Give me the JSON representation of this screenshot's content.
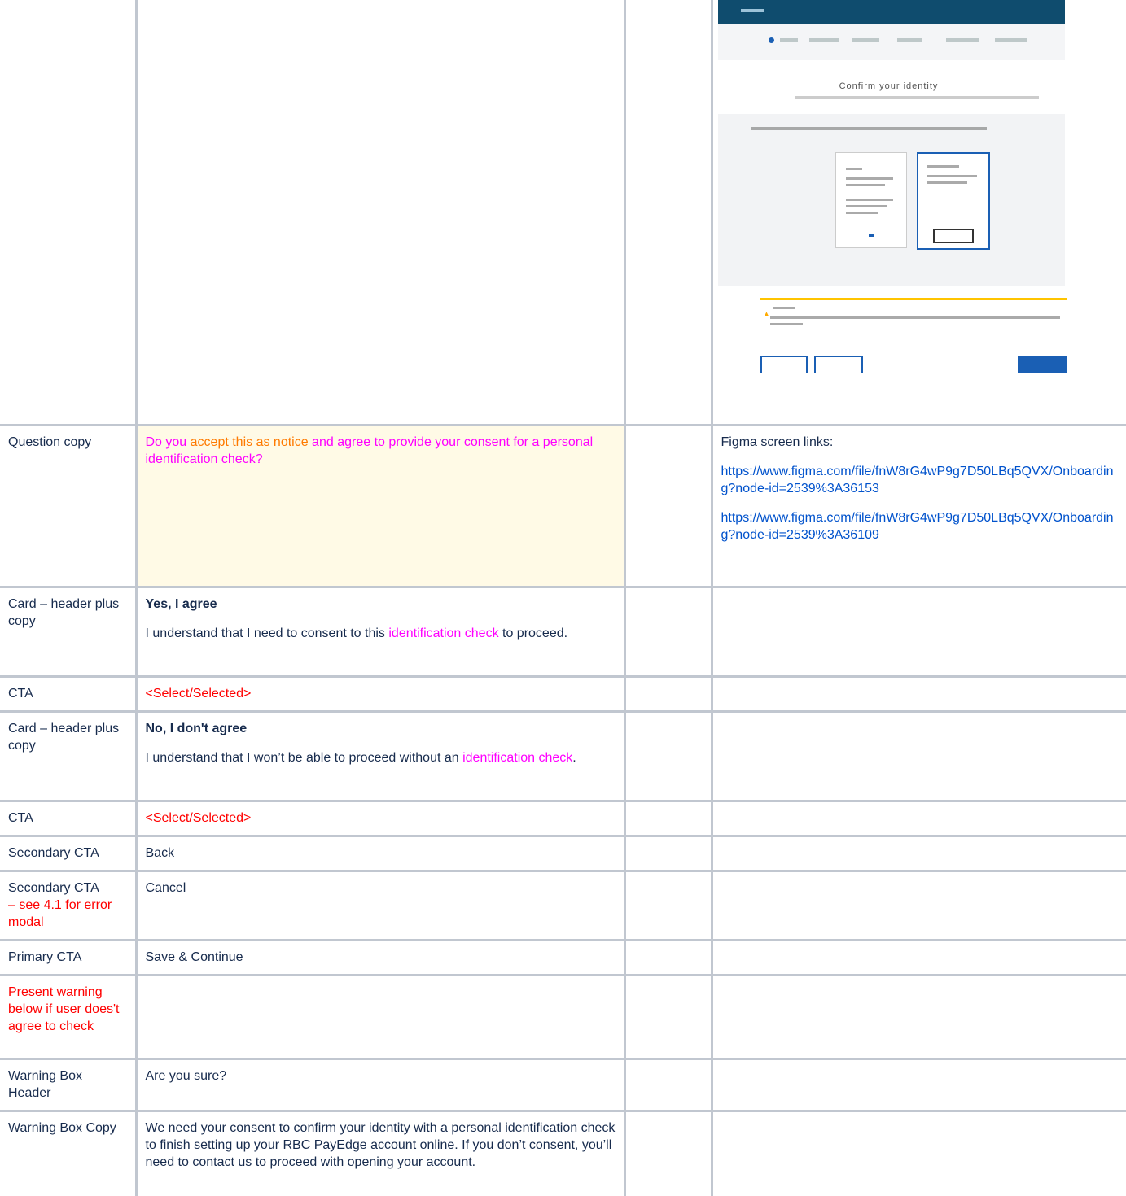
{
  "mock": {
    "title": "Confirm your identity"
  },
  "rows": {
    "question": {
      "label": "Question copy",
      "c1": "Do you ",
      "c2": "accept this as notice",
      "c3": " and ",
      "c4": "agree to provide your consent for a personal identification check?"
    },
    "figma": {
      "heading": "Figma screen links:",
      "link1": "https://www.figma.com/file/fnW8rG4wP9g7D50LBq5QVX/Onboarding?node-id=2539%3A36153",
      "link2": "https://www.figma.com/file/fnW8rG4wP9g7D50LBq5QVX/Onboarding?node-id=2539%3A36109"
    },
    "card1": {
      "label": "Card – header plus copy",
      "header": "Yes, I agree",
      "copy_a": "I understand that I need to consent to this ",
      "copy_b": "identification check",
      "copy_c": " to proceed."
    },
    "cta1": {
      "label": "CTA",
      "value": "<Select/Selected>"
    },
    "card2": {
      "label": "Card – header plus copy",
      "header": "No, I don't agree",
      "copy_a": "I understand that I won’t be able to proceed without an ",
      "copy_b": "identification check",
      "copy_c": "."
    },
    "cta2": {
      "label": "CTA",
      "value": "<Select/Selected>"
    },
    "secondary_back": {
      "label": "Secondary CTA",
      "value": "Back"
    },
    "secondary_cancel": {
      "label_a": "Secondary CTA",
      "label_b": "– see 4.1 for error modal",
      "value": "Cancel"
    },
    "primary": {
      "label": "Primary CTA",
      "value": "Save & Continue"
    },
    "warning_note": {
      "label": "Present warning below if user does't agree to check"
    },
    "warning_header": {
      "label": "Warning Box Header",
      "value": "Are you sure?"
    },
    "warning_copy": {
      "label": "Warning Box Copy",
      "value": "We need your consent to confirm your identity with a personal identification check to finish setting up your RBC PayEdge account online. If you don’t consent, you’ll need to contact us to proceed with opening your account."
    }
  }
}
